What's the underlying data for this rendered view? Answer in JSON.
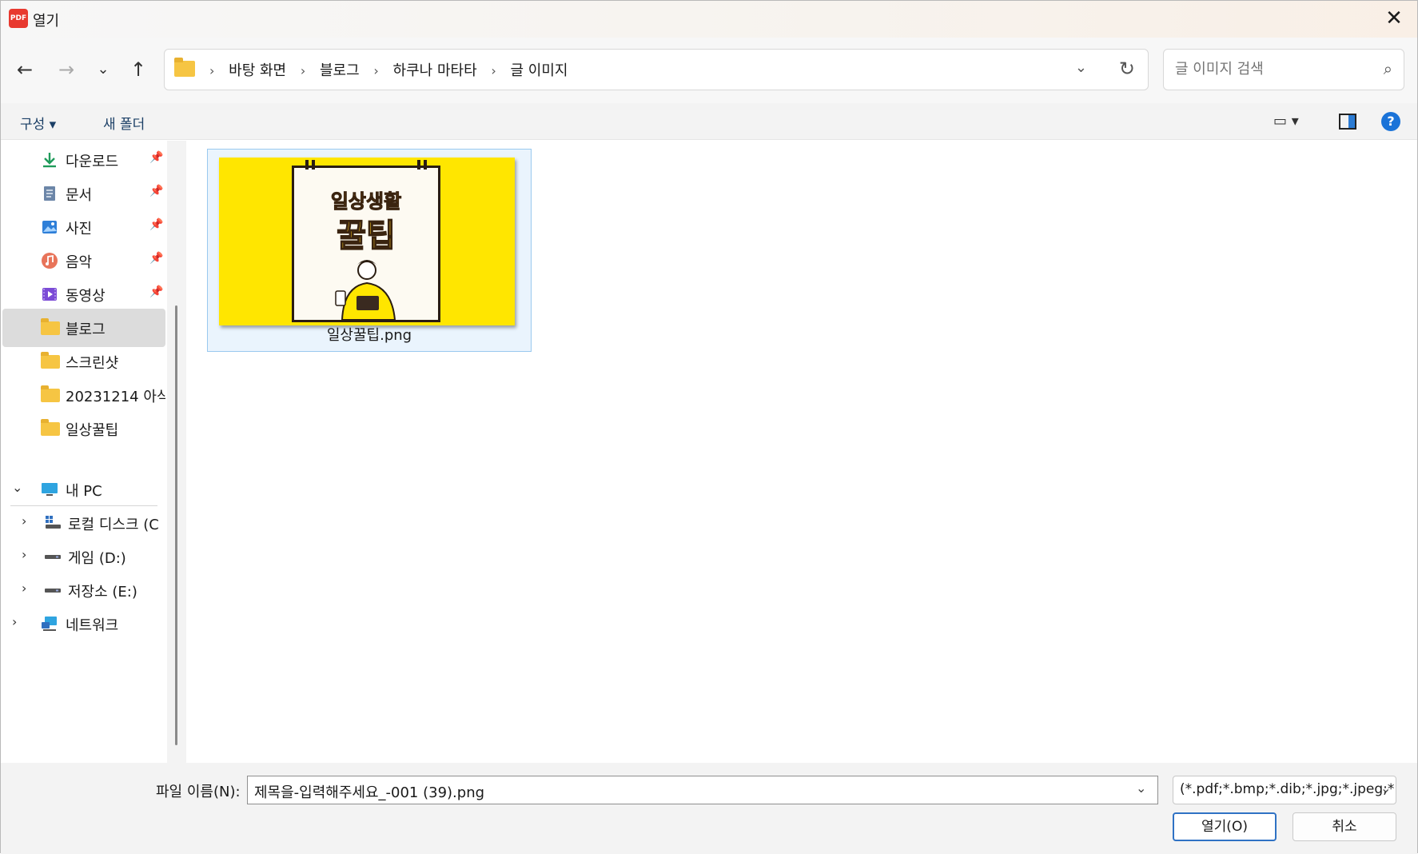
{
  "window": {
    "title": "열기",
    "app_icon_text": "PDF"
  },
  "nav": {
    "breadcrumb": [
      "바탕 화면",
      "블로그",
      "하쿠나 마타타",
      "글 이미지"
    ],
    "search_placeholder": "글 이미지 검색"
  },
  "toolbar": {
    "organize_label": "구성 ▾",
    "new_folder_label": "새 폴더"
  },
  "sidebar": {
    "quick_access": [
      {
        "label": "다운로드",
        "icon": "download-icon",
        "pinned": true
      },
      {
        "label": "문서",
        "icon": "document-icon",
        "pinned": true
      },
      {
        "label": "사진",
        "icon": "picture-icon",
        "pinned": true
      },
      {
        "label": "음악",
        "icon": "music-icon",
        "pinned": true
      },
      {
        "label": "동영상",
        "icon": "video-icon",
        "pinned": true
      },
      {
        "label": "블로그",
        "icon": "folder-icon",
        "selected": true
      },
      {
        "label": "스크린샷",
        "icon": "folder-icon"
      },
      {
        "label": "20231214 아식",
        "icon": "folder-icon"
      },
      {
        "label": "일상꿀팁",
        "icon": "folder-icon"
      }
    ],
    "this_pc": {
      "label": "내 PC",
      "icon": "pc-icon"
    },
    "drives": [
      {
        "label": "로컬 디스크 (C",
        "icon": "windows-drive-icon"
      },
      {
        "label": "게임 (D:)",
        "icon": "drive-icon"
      },
      {
        "label": "저장소 (E:)",
        "icon": "drive-icon"
      }
    ],
    "network": {
      "label": "네트워크",
      "icon": "network-icon"
    }
  },
  "content": {
    "files": [
      {
        "name": "일상꿀팁.png",
        "thumb_title_line1": "일상생활",
        "thumb_title_line2": "꿀팁"
      }
    ]
  },
  "bottom": {
    "filename_label": "파일 이름(N):",
    "filename_value": "제목을-입력해주세요_-001 (39).png",
    "filetype_value": "(*.pdf;*.bmp;*.dib;*.jpg;*.jpeg;*",
    "open_label": "열기(O)",
    "cancel_label": "취소"
  },
  "colors": {
    "accent": "#2f72c4",
    "selected_row": "#dcdcdc",
    "folder": "#f6c543",
    "thumb_bg": "#ffe600"
  }
}
